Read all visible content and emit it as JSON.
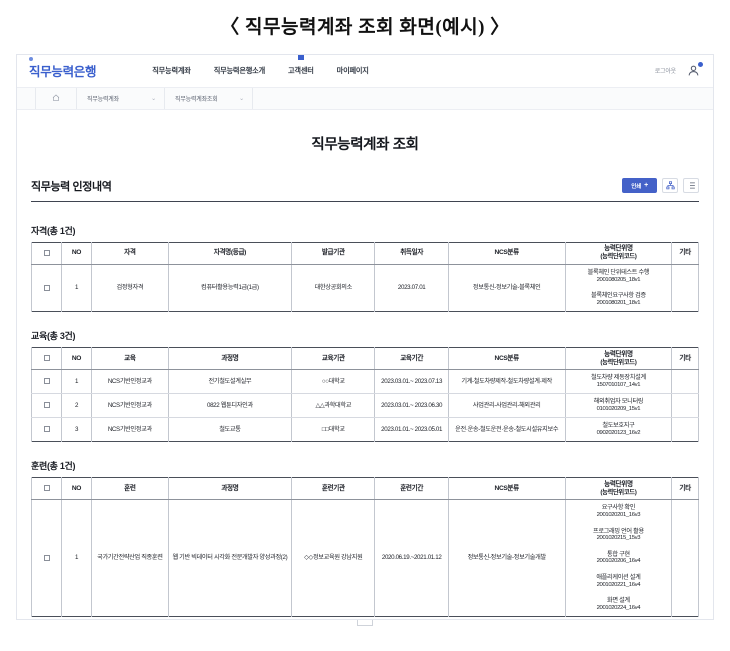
{
  "figure_caption": "〈 직무능력계좌 조회 화면(예시) 〉",
  "header": {
    "brand": "직무능력은행",
    "nav": [
      {
        "label": "직무능력계좌",
        "active": false
      },
      {
        "label": "직무능력은행소개",
        "active": false
      },
      {
        "label": "고객센터",
        "active": true
      },
      {
        "label": "마이페이지",
        "active": false
      }
    ],
    "logout_label": "로그아웃",
    "user_icon": "user-account-icon"
  },
  "breadcrumb": {
    "home_icon": "home-icon",
    "items": [
      {
        "label": "직무능력계좌",
        "chevron": "⌄"
      },
      {
        "label": "직무능력계좌조회",
        "chevron": "⌄"
      }
    ]
  },
  "page": {
    "title": "직무능력계좌 조회",
    "section_title": "직무능력 인정내역",
    "actions": {
      "primary_label": "인쇄",
      "primary_plus": "+",
      "tree_view_icon": "hierarchy-view-icon",
      "list_view_icon": "list-view-icon"
    }
  },
  "tables": [
    {
      "label": "자격(총 1건)",
      "columns": [
        "",
        "NO",
        "자격",
        "자격명(등급)",
        "발급기관",
        "취득일자",
        "NCS분류",
        "능력단위명",
        "기타"
      ],
      "unit_col_sub": "(능력단위코드)",
      "rows": [
        {
          "no": "1",
          "type": "검정형자격",
          "course": "컴퓨터활용능력1급(1급)",
          "org": "대한상공회의소",
          "period": "2023.07.01",
          "ncs": "정보통신-정보기술-블록체인",
          "units": [
            {
              "name": "블록체인 단위테스트 수행",
              "code": "2001080205_18v1"
            },
            {
              "name": "블록체인요구사항 검증",
              "code": "2001080201_18v1"
            }
          ],
          "etc": ""
        }
      ]
    },
    {
      "label": "교육(총 3건)",
      "columns": [
        "",
        "NO",
        "교육",
        "과정명",
        "교육기관",
        "교육기간",
        "NCS분류",
        "능력단위명",
        "기타"
      ],
      "unit_col_sub": "(능력단위코드)",
      "rows": [
        {
          "no": "1",
          "type": "NCS기반인정교과",
          "course": "전기철도설계실무",
          "org": "○○대학교",
          "period": "2023.03.01.~ 2023.07.13",
          "ncs": "기계-철도차량제작-철도차량설계·제작",
          "units": [
            {
              "name": "철도차량 제동장치설계",
              "code": "1507010107_14v1"
            }
          ],
          "etc": ""
        },
        {
          "no": "2",
          "type": "NCS기반인정교과",
          "course": "0822 웹툰디자인과",
          "org": "△△과학대학교",
          "period": "2023.03.01.~ 2023.06.30",
          "ncs": "사업관리-사업관리-해외관리",
          "units": [
            {
              "name": "해외취업자 모니터링",
              "code": "0101020209_15v1"
            }
          ],
          "etc": ""
        },
        {
          "no": "3",
          "type": "NCS기반인정교과",
          "course": "철도교통",
          "org": "□□대학교",
          "period": "2023.01.01.~ 2023.05.01",
          "ncs": "운전·운송-철도운전·운송-철도시설유지보수",
          "units": [
            {
              "name": "철도보호지구",
              "code": "0902020123_16v2"
            }
          ],
          "etc": ""
        }
      ]
    },
    {
      "label": "훈련(총 1건)",
      "columns": [
        "",
        "NO",
        "훈련",
        "과정명",
        "훈련기관",
        "훈련기간",
        "NCS분류",
        "능력단위명",
        "기타"
      ],
      "unit_col_sub": "(능력단위코드)",
      "rows": [
        {
          "no": "1",
          "type": "국가기간전략산업 직종훈련",
          "course": "웹 기반 빅데이터 시각화 전문개발자 양성과정(2)",
          "org": "◇◇정보교육원 강남지원",
          "period": "2020.06.19.~2021.01.12",
          "ncs": "정보통신-정보기술-정보기술개발",
          "units": [
            {
              "name": "요구사항 확인",
              "code": "2001020201_16v3"
            },
            {
              "name": "프로그래밍 언어 활용",
              "code": "2001020215_15v3"
            },
            {
              "name": "통합 구현",
              "code": "2001020206_16v4"
            },
            {
              "name": "애플리케이션 설계",
              "code": "2001020221_16v4"
            },
            {
              "name": "화면 설계",
              "code": "2001020224_16v4"
            }
          ],
          "etc": ""
        }
      ]
    }
  ],
  "colors": {
    "brand_blue": "#3a5fcd",
    "button_blue": "#4461c8",
    "rule_dark": "#4a4f59"
  }
}
